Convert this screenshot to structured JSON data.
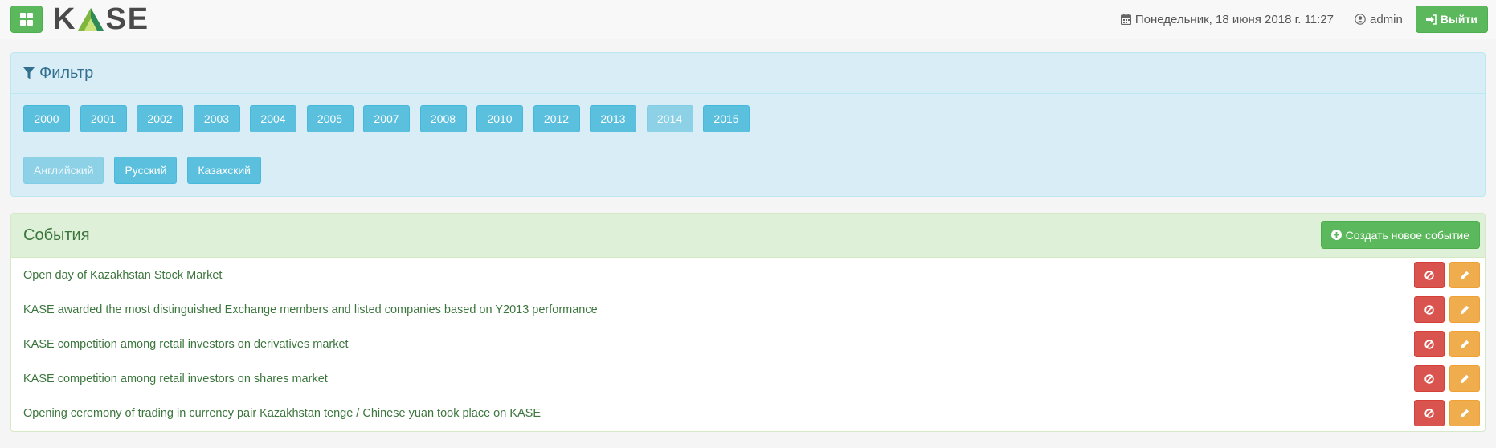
{
  "header": {
    "logo_text_left": "K",
    "logo_text_right": "SE",
    "datetime": "Понедельник, 18 июня 2018 г. 11:27",
    "user": "admin",
    "logout_label": "Выйти"
  },
  "filter": {
    "title": "Фильтр",
    "years": [
      {
        "label": "2000",
        "active": true
      },
      {
        "label": "2001",
        "active": true
      },
      {
        "label": "2002",
        "active": true
      },
      {
        "label": "2003",
        "active": true
      },
      {
        "label": "2004",
        "active": true
      },
      {
        "label": "2005",
        "active": true
      },
      {
        "label": "2007",
        "active": true
      },
      {
        "label": "2008",
        "active": true
      },
      {
        "label": "2010",
        "active": true
      },
      {
        "label": "2012",
        "active": true
      },
      {
        "label": "2013",
        "active": true
      },
      {
        "label": "2014",
        "active": false
      },
      {
        "label": "2015",
        "active": true
      }
    ],
    "languages": [
      {
        "label": "Английский",
        "active": false
      },
      {
        "label": "Русский",
        "active": true
      },
      {
        "label": "Казахский",
        "active": true
      }
    ]
  },
  "events": {
    "title": "События",
    "create_label": "Создать новое событие",
    "items": [
      {
        "title": "Open day of Kazakhstan Stock Market"
      },
      {
        "title": "KASE awarded the most distinguished Exchange members and listed companies based on Y2013 performance"
      },
      {
        "title": "KASE competition among retail investors on derivatives market"
      },
      {
        "title": "KASE competition among retail investors on shares market"
      },
      {
        "title": "Opening ceremony of trading in currency pair Kazakhstan tenge / Chinese yuan took place on KASE"
      }
    ]
  },
  "colors": {
    "success": "#5cb85c",
    "info": "#5bc0de",
    "danger": "#d9534f",
    "warning": "#f0ad4e",
    "info_panel": "#d9edf7",
    "success_panel": "#dff0d8"
  },
  "icons": {
    "menu": "grid-icon",
    "date": "calendar-icon",
    "user": "user-icon",
    "logout": "sign-in-icon",
    "filter": "filter-icon",
    "create": "plus-circle-icon",
    "delete": "ban-icon",
    "edit": "pencil-icon"
  }
}
